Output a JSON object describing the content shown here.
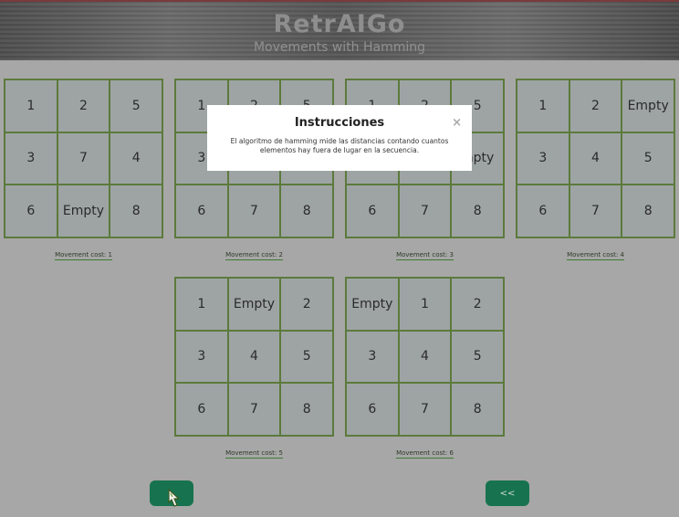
{
  "header": {
    "title": "RetrAIGo",
    "subtitle": "Movements with Hamming"
  },
  "boards": [
    {
      "cells": [
        "1",
        "2",
        "5",
        "3",
        "7",
        "4",
        "6",
        "Empty",
        "8"
      ],
      "cost": "Movement cost: 1"
    },
    {
      "cells": [
        "1",
        "2",
        "5",
        "3",
        "",
        "",
        "6",
        "7",
        "8"
      ],
      "cost": "Movement cost: 2"
    },
    {
      "cells": [
        "1",
        "2",
        "5",
        "",
        "",
        "mpty",
        "6",
        "7",
        "8"
      ],
      "cost": "Movement cost: 3"
    },
    {
      "cells": [
        "1",
        "2",
        "Empty",
        "3",
        "4",
        "5",
        "6",
        "7",
        "8"
      ],
      "cost": "Movement cost: 4"
    },
    {
      "cells": [
        "1",
        "Empty",
        "2",
        "3",
        "4",
        "5",
        "6",
        "7",
        "8"
      ],
      "cost": "Movement cost: 5"
    },
    {
      "cells": [
        "Empty",
        "1",
        "2",
        "3",
        "4",
        "5",
        "6",
        "7",
        "8"
      ],
      "cost": "Movement cost: 6"
    }
  ],
  "buttons": {
    "left_label": "",
    "back_label": "<<",
    "color": "#17734f"
  },
  "modal": {
    "title": "Instrucciones",
    "close": "×",
    "body": "El algoritmo de hamming mide las distancias contando cuantos elementos hay fuera de lugar en la secuencia."
  }
}
